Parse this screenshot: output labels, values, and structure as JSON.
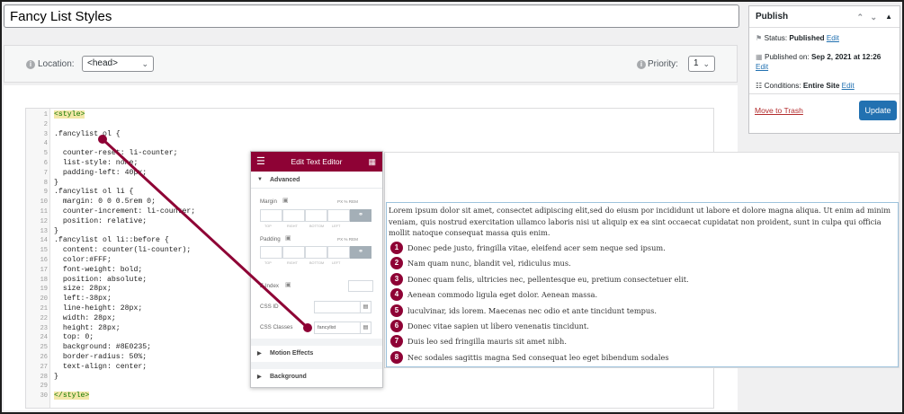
{
  "page": {
    "title": "Fancy List Styles"
  },
  "location_bar": {
    "location_label": "Location:",
    "location_value": "<head>",
    "priority_label": "Priority:",
    "priority_value": "1",
    "info_glyph": "i"
  },
  "code_lines": [
    {
      "n": "1",
      "t": "<style>",
      "cls": "tag"
    },
    {
      "n": "2",
      "t": "",
      "cls": ""
    },
    {
      "n": "3",
      "t": ".fancylist ol {",
      "cls": ""
    },
    {
      "n": "4",
      "t": "",
      "cls": ""
    },
    {
      "n": "5",
      "t": "  counter-reset: li-counter;",
      "cls": ""
    },
    {
      "n": "6",
      "t": "  list-style: none;",
      "cls": ""
    },
    {
      "n": "7",
      "t": "  padding-left: 40px;",
      "cls": ""
    },
    {
      "n": "8",
      "t": "}",
      "cls": ""
    },
    {
      "n": "9",
      "t": ".fancylist ol li {",
      "cls": ""
    },
    {
      "n": "10",
      "t": "  margin: 0 0 0.5rem 0;",
      "cls": ""
    },
    {
      "n": "11",
      "t": "  counter-increment: li-counter;",
      "cls": ""
    },
    {
      "n": "12",
      "t": "  position: relative;",
      "cls": ""
    },
    {
      "n": "13",
      "t": "}",
      "cls": ""
    },
    {
      "n": "14",
      "t": ".fancylist ol li::before {",
      "cls": ""
    },
    {
      "n": "15",
      "t": "  content: counter(li-counter);",
      "cls": ""
    },
    {
      "n": "16",
      "t": "  color:#FFF;",
      "cls": ""
    },
    {
      "n": "17",
      "t": "  font-weight: bold;",
      "cls": ""
    },
    {
      "n": "18",
      "t": "  position: absolute;",
      "cls": ""
    },
    {
      "n": "19",
      "t": "  size: 28px;",
      "cls": ""
    },
    {
      "n": "20",
      "t": "  left:-38px;",
      "cls": ""
    },
    {
      "n": "21",
      "t": "  line-height: 28px;",
      "cls": ""
    },
    {
      "n": "22",
      "t": "  width: 28px;",
      "cls": ""
    },
    {
      "n": "23",
      "t": "  height: 28px;",
      "cls": ""
    },
    {
      "n": "24",
      "t": "  top: 0;",
      "cls": ""
    },
    {
      "n": "25",
      "t": "  background: #8E0235;",
      "cls": ""
    },
    {
      "n": "26",
      "t": "  border-radius: 50%;",
      "cls": ""
    },
    {
      "n": "27",
      "t": "  text-align: center;",
      "cls": ""
    },
    {
      "n": "28",
      "t": "}",
      "cls": ""
    },
    {
      "n": "29",
      "t": "",
      "cls": ""
    },
    {
      "n": "30",
      "t": "</style>",
      "cls": "tag"
    }
  ],
  "publish": {
    "title": "Publish",
    "status_label": "Status:",
    "status_value": "Published",
    "published_label": "Published on:",
    "published_value": "Sep 2, 2021 at 12:26",
    "conditions_label": "Conditions:",
    "conditions_value": "Entire Site",
    "edit_label": "Edit",
    "trash_label": "Move to Trash",
    "update_label": "Update"
  },
  "panel": {
    "title": "Edit Text Editor",
    "advanced_label": "Advanced",
    "margin_label": "Margin",
    "padding_label": "Padding",
    "units": "PX  %  REM",
    "sub_labels": [
      "TOP",
      "RIGHT",
      "BOTTOM",
      "LEFT"
    ],
    "zindex_label": "Z-Index",
    "cssid_label": "CSS ID",
    "cssclasses_label": "CSS Classes",
    "cssclasses_value": "fancylist",
    "motion_label": "Motion Effects",
    "background_label": "Background"
  },
  "preview": {
    "paragraph": "Lorem ipsum dolor sit amet, consectet adipiscing elit,sed do eiusm por incididunt ut labore et dolore magna aliqua. Ut enim ad minim veniam, quis nostrud exercitation ullamco laboris nisi ut aliquip ex ea sint occaecat cupidatat non proident, sunt in culpa qui officia mollit natoque consequat massa quis enim.",
    "items": [
      {
        "num": "1",
        "text": "Donec pede justo, fringilla vitae, eleifend acer sem neque sed ipsum."
      },
      {
        "num": "2",
        "text": "Nam quam nunc, blandit vel, ridiculus mus."
      },
      {
        "num": "3",
        "text": "Donec quam felis, ultricies nec, pellentesque eu, pretium consectetuer elit."
      },
      {
        "num": "4",
        "text": "Aenean commodo ligula eget dolor. Aenean massa."
      },
      {
        "num": "5",
        "text": "luculvinar, ids lorem. Maecenas nec odio et ante tincidunt tempus."
      },
      {
        "num": "6",
        "text": "Donec vitae sapien ut libero venenatis tincidunt."
      },
      {
        "num": "7",
        "text": "Duis leo sed fringilla mauris sit amet nibh."
      },
      {
        "num": "8",
        "text": "Nec sodales sagittis magna Sed consequat leo eget bibendum sodales"
      }
    ]
  },
  "colors": {
    "accent": "#8e0235",
    "primary_button": "#2271b1",
    "link": "#2271b1",
    "trash": "#b32d2e"
  },
  "icons": {
    "info": "info-icon",
    "calendar": "calendar-icon",
    "sitemap": "sitemap-icon",
    "menu": "hamburger-icon",
    "grid": "grid-icon",
    "link": "link-icon",
    "trash": "trash-icon",
    "monitor": "monitor-icon"
  }
}
